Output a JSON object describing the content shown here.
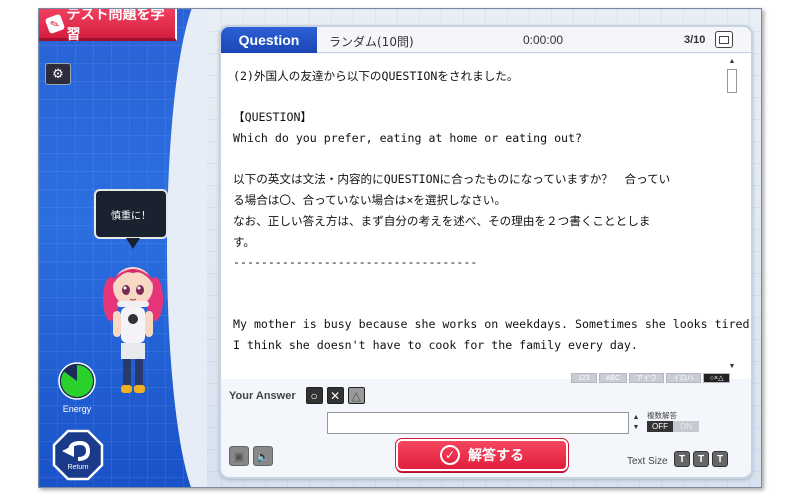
{
  "app": {
    "title": "テスト問題を学習",
    "title_icon": "pencil-icon",
    "settings_icon": "gear-icon"
  },
  "mascot": {
    "speech": "慎重に！"
  },
  "energy": {
    "label": "Energy",
    "level": 0.85,
    "color": "#2ad12a"
  },
  "return_button": {
    "label": "Return",
    "icon": "return-arrow-icon"
  },
  "header": {
    "tab_label": "Question",
    "mode": "ランダム(10問)",
    "timer": "0:00:00",
    "progress": "3/10",
    "list_icon": "list-icon"
  },
  "question": {
    "lines": [
      "(2)外国人の友達から以下のQUESTIONをされました。",
      "",
      "【QUESTION】",
      "Which do you prefer, eating at home or eating out?",
      "",
      "以下の英文は文法・内容的にQUESTIONに合ったものになっていますか？　合ってい",
      "る場合は〇、合っていない場合は×を選択しなさい。",
      "なお、正しい答え方は、まず自分の考えを述べ、その理由を２つ書くこととしま",
      "す。",
      "-----------------------------------",
      "",
      "",
      "My mother is busy because she works on weekdays. Sometimes she looks tired.",
      "I think she doesn't have to cook for the family every day."
    ]
  },
  "input_modes": [
    "123",
    "ABC",
    "アイウ",
    "イロハ",
    "○×△"
  ],
  "answer": {
    "label": "Your Answer",
    "symbols": [
      "○",
      "✕",
      "△"
    ],
    "value": "",
    "multi_label": "複数解答",
    "multi_off": "OFF",
    "multi_on": "ON"
  },
  "submit": {
    "label": "解答する",
    "icon": "check-circle-icon"
  },
  "text_size": {
    "label": "Text Size",
    "options": [
      "T",
      "T",
      "T"
    ]
  },
  "colors": {
    "accent_red": "#e01f3d",
    "question_blue": "#2c5fd6",
    "left_panel_blue": "#2b6fe0"
  }
}
